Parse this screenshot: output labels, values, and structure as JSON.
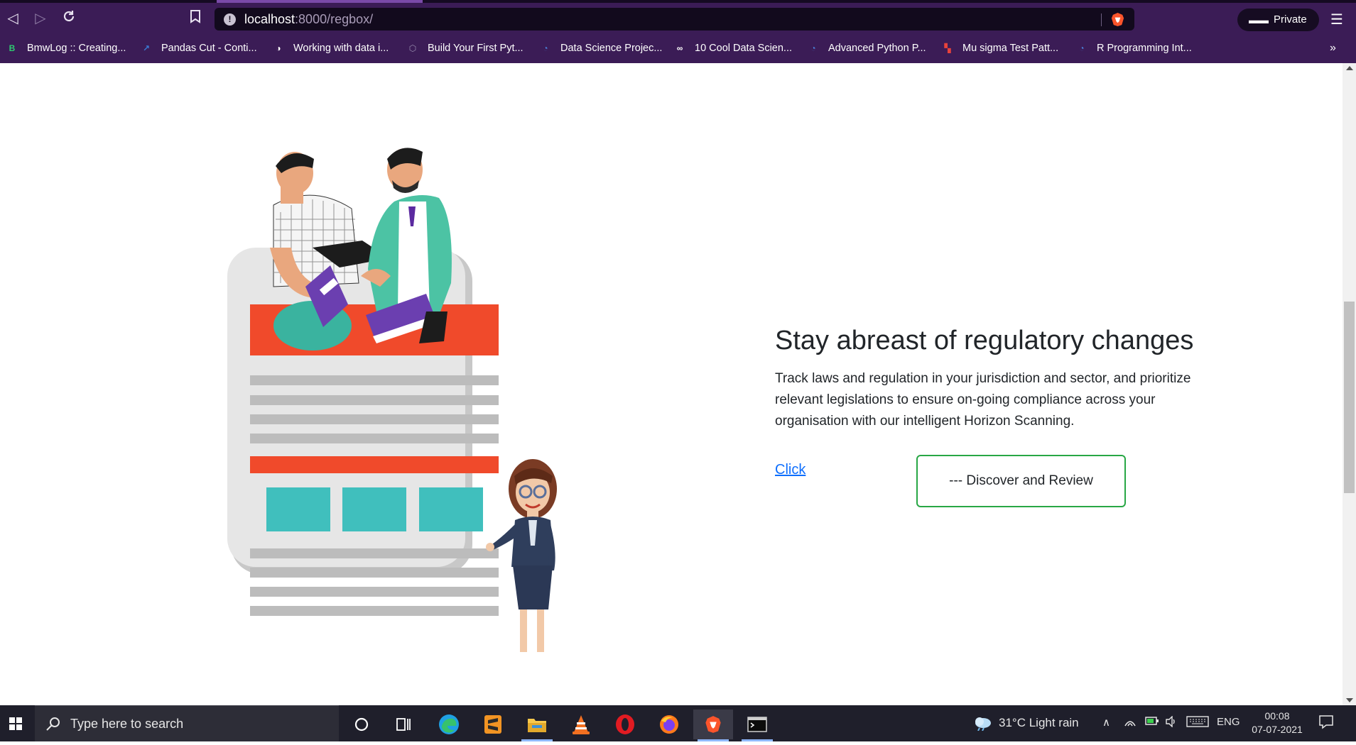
{
  "browser": {
    "url_host": "localhost",
    "url_rest": ":8000/regbox/",
    "private_label": "Private"
  },
  "bookmarks": [
    {
      "label": "BmwLog :: Creating...",
      "icon": "b-logo-icon",
      "color": "#2ecc71",
      "glyph": "B"
    },
    {
      "label": "Pandas Cut - Conti...",
      "icon": "chart-icon",
      "color": "#3a7bd5",
      "glyph": "↗"
    },
    {
      "label": "Working with data i...",
      "icon": "globe-icon",
      "color": "#ffffff",
      "glyph": "◑"
    },
    {
      "label": "Build Your First Pyt...",
      "icon": "hex-icon",
      "color": "#9a8fb0",
      "glyph": "⬡"
    },
    {
      "label": "Data Science Projec...",
      "icon": "planet-icon",
      "color": "#4a7fd6",
      "glyph": "◔"
    },
    {
      "label": "10 Cool Data Scien...",
      "icon": "infinity-icon",
      "color": "#ffffff",
      "glyph": "∞"
    },
    {
      "label": "Advanced Python P...",
      "icon": "planet-icon",
      "color": "#4a7fd6",
      "glyph": "◔"
    },
    {
      "label": "Mu sigma Test Patt...",
      "icon": "red-tile-icon",
      "color": "#e8423b",
      "glyph": "▚"
    },
    {
      "label": "R Programming Int...",
      "icon": "planet-icon",
      "color": "#4a7fd6",
      "glyph": "◔"
    }
  ],
  "hero": {
    "title": "Stay abreast of regulatory changes",
    "text": "Track laws and regulation in your jurisdiction and sector, and prioritize relevant legislations to ensure on-going compliance across your organisation with our intelligent Horizon Scanning.",
    "link_label": "Click",
    "button_label": "--- Discover and Review"
  },
  "taskbar": {
    "search_placeholder": "Type here to search",
    "weather": "31°C  Light rain",
    "language": "ENG",
    "time": "00:08",
    "date": "07-07-2021"
  }
}
